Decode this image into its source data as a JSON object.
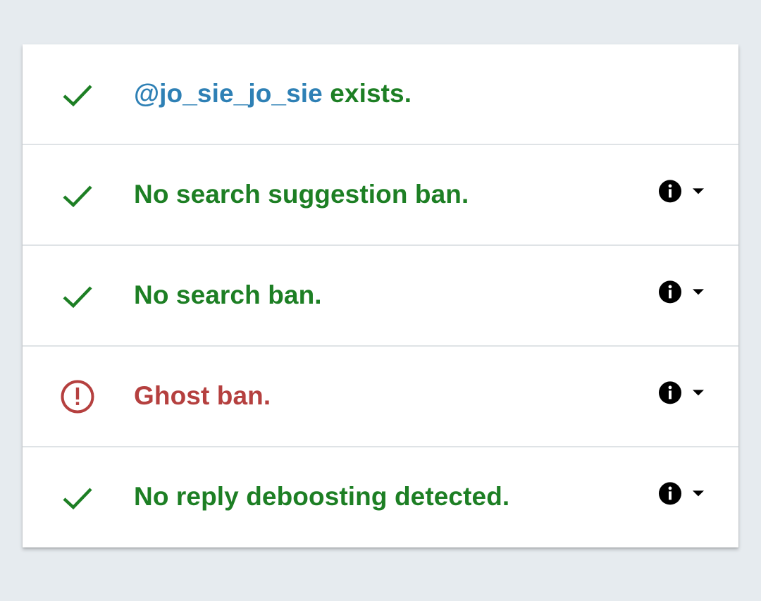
{
  "theme": {
    "background": "#e6ebef",
    "card": "#ffffff",
    "ok_color": "#1d7f24",
    "error_color": "#b5403f",
    "user_color": "#2e80b5"
  },
  "rows": [
    {
      "status": "ok",
      "status_icon": "check-icon",
      "username": "@jo_sie_jo_sie",
      "text": " exists.",
      "has_actions": false
    },
    {
      "status": "ok",
      "status_icon": "check-icon",
      "text": "No search suggestion ban.",
      "has_actions": true,
      "actions": [
        "info-icon",
        "caret-down-icon"
      ]
    },
    {
      "status": "ok",
      "status_icon": "check-icon",
      "text": "No search ban.",
      "has_actions": true,
      "actions": [
        "info-icon",
        "caret-down-icon"
      ]
    },
    {
      "status": "error",
      "status_icon": "alert-circle-icon",
      "text": "Ghost ban.",
      "has_actions": true,
      "actions": [
        "info-icon",
        "caret-down-icon"
      ]
    },
    {
      "status": "ok",
      "status_icon": "check-icon",
      "text": "No reply deboosting detected.",
      "has_actions": true,
      "actions": [
        "info-icon",
        "caret-down-icon"
      ]
    }
  ]
}
